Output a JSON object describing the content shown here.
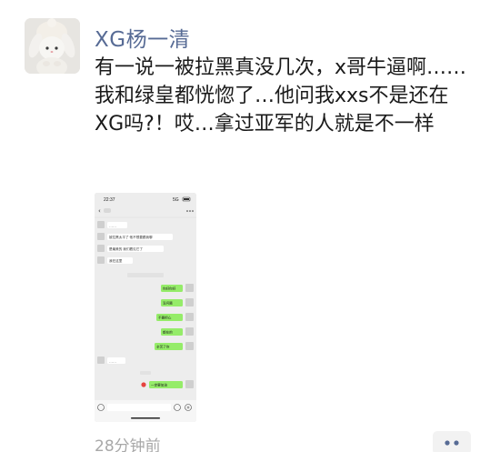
{
  "post": {
    "author": "XG杨一清",
    "content": "有一说一被拉黑真没几次，x哥牛逼啊……我和绿皇都恍惚了…他问我xxs不是还在XG吗?！哎…拿过亚军的人就是不一样",
    "time": "28分钟前"
  },
  "screenshot": {
    "status_time": "22:37",
    "status_right": "5G",
    "top_title": "",
    "messages": [
      {
        "side": "left",
        "text": "……"
      },
      {
        "side": "left",
        "text": "被拉黑太平了 他不想要跟我聊"
      },
      {
        "side": "left",
        "text": "是最美的 我们看见它了"
      },
      {
        "side": "left",
        "text": "我在这里"
      },
      {
        "side": "right",
        "text": "你好你好"
      },
      {
        "side": "right",
        "text": "没问题"
      },
      {
        "side": "right",
        "text": "不要担心"
      },
      {
        "side": "right",
        "text": "都在的"
      },
      {
        "side": "right",
        "text": "辛苦了你"
      },
      {
        "side": "left",
        "text": "……"
      },
      {
        "side": "right",
        "text": "一定要加油"
      }
    ]
  },
  "colors": {
    "name": "#576b95",
    "bubble_green": "#95ec69",
    "time": "#a8a8a8"
  }
}
